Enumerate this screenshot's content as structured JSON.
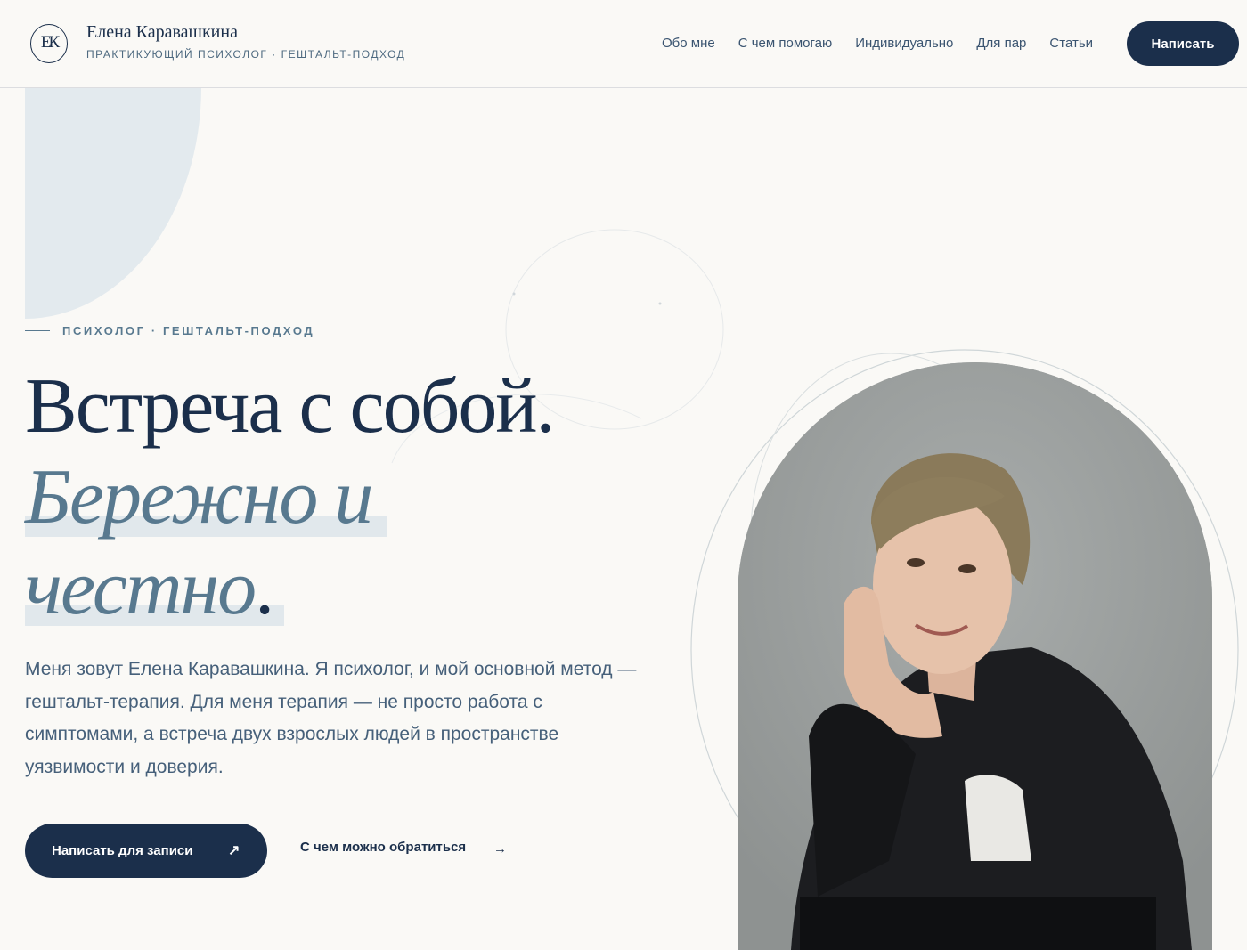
{
  "header": {
    "logo_monogram": "ЕК",
    "brand_name": "Елена Каравашкина",
    "brand_subtitle": "ПРАКТИКУЮЩИЙ ПСИХОЛОГ · ГЕШТАЛЬТ-ПОДХОД",
    "nav": [
      "Обо мне",
      "С чем помогаю",
      "Индивидуально",
      "Для пар",
      "Статьи"
    ],
    "cta_label": "Написать"
  },
  "hero": {
    "eyebrow": "ПСИХОЛОГ · ГЕШТАЛЬТ-ПОДХОД",
    "title_line1": "Встреча с собой.",
    "title_italic_1": "Бережно и",
    "title_italic_2": "честно",
    "title_dot": ".",
    "lead": "Меня зовут Елена Каравашкина. Я психолог, и мой основной метод — гештальт-терапия. Для меня терапия — не просто работа с симптомами, а встреча двух взрослых людей в пространстве уязвимости и доверия.",
    "primary_button": "Написать для записи",
    "primary_button_icon": "arrow-up-right-icon",
    "secondary_link": "С чем можно обратиться",
    "secondary_link_icon": "arrow-right-icon"
  },
  "colors": {
    "navy": "#1b2f4b",
    "slate_blue": "#58798f",
    "highlight": "#e1e8ec",
    "background": "#faf9f6"
  }
}
